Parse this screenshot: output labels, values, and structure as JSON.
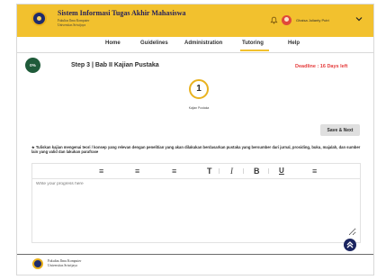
{
  "header": {
    "title": "Sistem Informasi Tugas Akhir Mahasiswa",
    "subtitle_line1": "Fakultas Ilmu Komputer",
    "subtitle_line2": "Universitas Sriwijaya",
    "user_name": "Ghaisa Julianty Putri"
  },
  "nav": {
    "items": [
      "Home",
      "Guidelines",
      "Administration",
      "Tutoring",
      "Help"
    ],
    "active": "Tutoring"
  },
  "progress": {
    "label": "0%",
    "value": 0
  },
  "step": {
    "title": "Step 3 | Bab II Kajian Pustaka",
    "deadline": "Deadline : 16 Days left",
    "number": "1",
    "label": "Kajian Pustaka"
  },
  "actions": {
    "save_label": "Save & Next"
  },
  "instruction": "★ Tuliskan kajian mengenai teori / konsep yang relevan dengan penelitian yang akan dilakukan berdasarkan pustaka yang bersumber dari jurnal, prosiding, buku, majalah, dan sumber lain yang valid dan lakukan parafrase",
  "editor": {
    "placeholder": "Write your progress here",
    "toolbar": {
      "align_left": "≡",
      "align_center": "≡",
      "align_right": "≡",
      "text_size": "T",
      "italic": "I",
      "bold": "B",
      "underline": "U",
      "list": "≡"
    }
  },
  "footer": {
    "line1": "Fakultas Ilmu Komputer",
    "line2": "Universitas Sriwijaya"
  },
  "colors": {
    "primary_yellow": "#f2c12e",
    "navy": "#1f2c6d",
    "deadline_red": "#e53b3b",
    "progress_green": "#1f5b3a"
  },
  "icons": [
    "university-logo-icon",
    "bell-icon",
    "avatar",
    "chevron-down-icon",
    "chevron-up-icon"
  ]
}
